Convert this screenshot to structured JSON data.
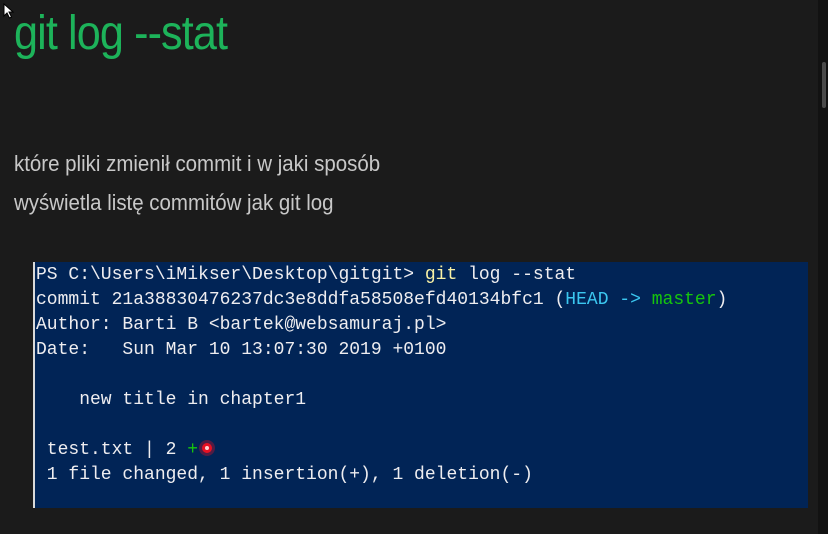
{
  "slide": {
    "title": "git log --stat",
    "subtitle_lines": [
      "które pliki zmienił commit i w jaki sposób",
      "wyświetla listę commitów jak git log"
    ]
  },
  "terminal": {
    "prompt": "PS C:\\Users\\iMikser\\Desktop\\gitgit> ",
    "command": "git",
    "command_args": " log --stat",
    "commit_prefix": "commit 21a38830476237dc3e8ddfa58508efd40134bfc1 (",
    "head_ref": "HEAD ->",
    "branch": " master",
    "commit_suffix": ")",
    "author_line": "Author: Barti B <bartek@websamuraj.pl>",
    "date_line": "Date:   Sun Mar 10 13:07:30 2019 +0100",
    "message_line": "    new title in chapter1",
    "stat_file": " test.txt | 2 ",
    "stat_plus": "+",
    "summary_line": " 1 file changed, 1 insertion(+), 1 deletion(-)"
  },
  "colors": {
    "title_green": "#1db35a",
    "terminal_bg": "#012456",
    "head_cyan": "#3bc7f0",
    "branch_green": "#16c60c",
    "command_yellow": "#f9f1a5"
  },
  "icons": {
    "cursor": "mouse-pointer-icon",
    "click_marker": "click-indicator-icon"
  }
}
